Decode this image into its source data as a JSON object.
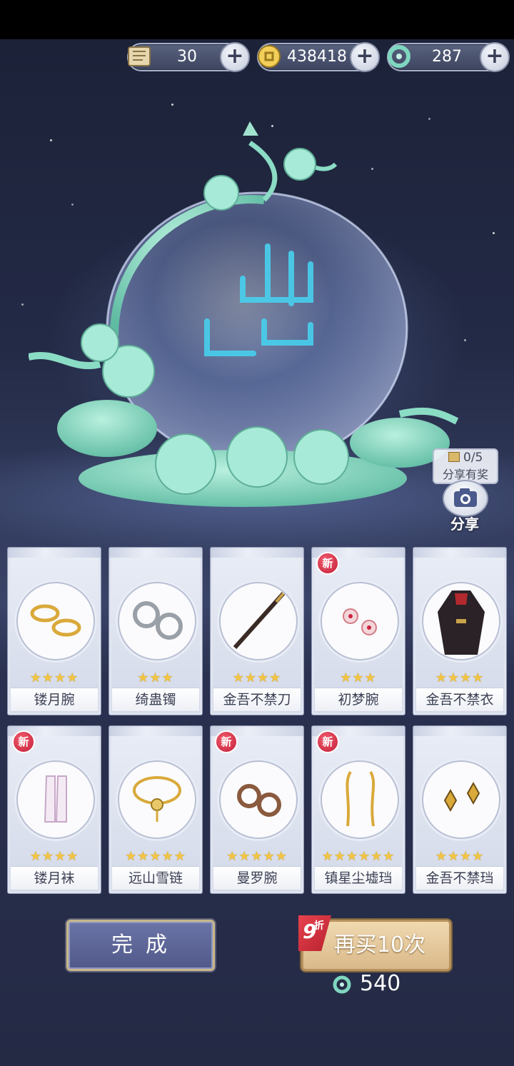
{
  "currencies": [
    {
      "icon": "scroll-icon",
      "value": "30"
    },
    {
      "icon": "coin-icon",
      "value": "438418"
    },
    {
      "icon": "jade-icon",
      "value": "287"
    }
  ],
  "plus_label": "+",
  "share": {
    "count": "0/5",
    "reward_label": "分享有奖",
    "button_label": "分享"
  },
  "items": [
    {
      "name": "镂月腕",
      "stars": "★★★★",
      "is_new": false
    },
    {
      "name": "绮蛊镯",
      "stars": "★★★",
      "is_new": false
    },
    {
      "name": "金吾不禁刀",
      "stars": "★★★★",
      "is_new": false
    },
    {
      "name": "初梦腕",
      "stars": "★★★",
      "is_new": true
    },
    {
      "name": "金吾不禁衣",
      "stars": "★★★★",
      "is_new": false
    },
    {
      "name": "镂月袜",
      "stars": "★★★★",
      "is_new": true
    },
    {
      "name": "远山雪链",
      "stars": "★★★★★",
      "is_new": false
    },
    {
      "name": "曼罗腕",
      "stars": "★★★★★",
      "is_new": true
    },
    {
      "name": "镇星尘墟珰",
      "stars": "★★★★★★",
      "is_new": true
    },
    {
      "name": "金吾不禁珰",
      "stars": "★★★★",
      "is_new": false
    }
  ],
  "new_badge": "新",
  "buttons": {
    "done": "完成",
    "again": "再买10次",
    "discount_number": "9",
    "discount_label": "折"
  },
  "cost": {
    "icon": "jade-icon",
    "value": "540"
  },
  "colors": {
    "jade": "#7fd6bf",
    "gold_star": "#f2c443",
    "new_badge": "#d8304a"
  }
}
